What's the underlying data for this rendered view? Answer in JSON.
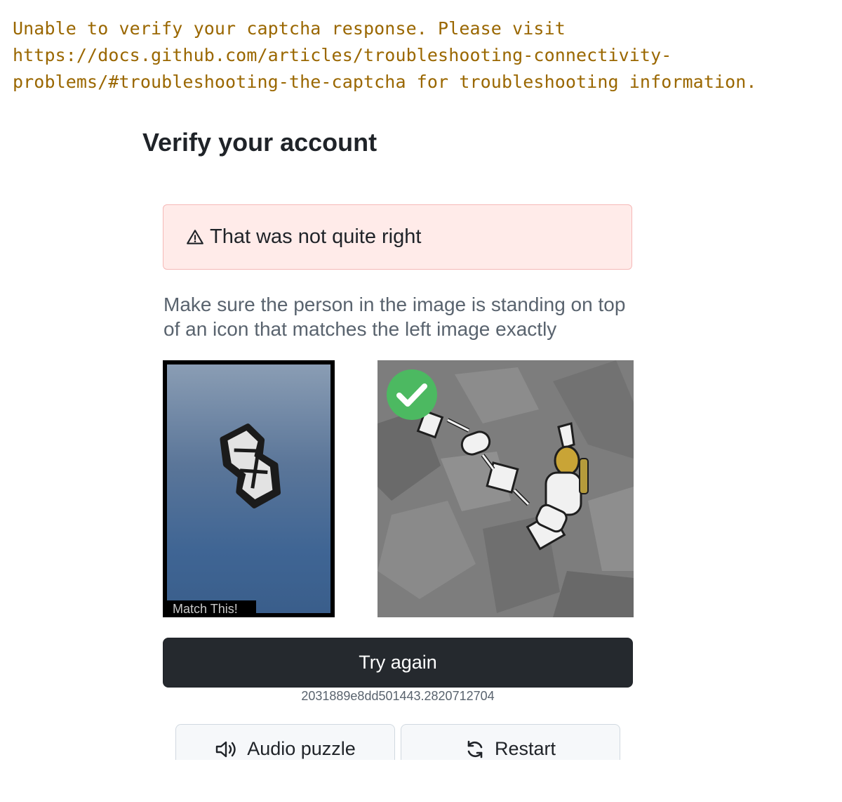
{
  "error_banner": {
    "text": "Unable to verify your captcha response. Please visit\nhttps://docs.github.com/articles/troubleshooting-connectivity-\nproblems/#troubleshooting-the-captcha for troubleshooting information."
  },
  "page": {
    "title": "Verify your account"
  },
  "alert": {
    "icon": "alert-triangle-icon",
    "text": "That was not quite right"
  },
  "puzzle": {
    "instructions": "Make sure the person in the image is standing on top of an icon that matches the left image exactly",
    "target_caption": "Match This!",
    "selected_indicator": "check-circle-icon",
    "colors": {
      "check_green": "#4cb961",
      "target_bg_top": "#8a9db4",
      "target_bg_bottom": "#3a5e8b"
    }
  },
  "actions": {
    "try_again_label": "Try again",
    "session_id": "2031889e8dd501443.2820712704",
    "audio_label": "Audio puzzle",
    "audio_icon": "speaker-icon",
    "restart_label": "Restart",
    "restart_icon": "refresh-icon"
  }
}
